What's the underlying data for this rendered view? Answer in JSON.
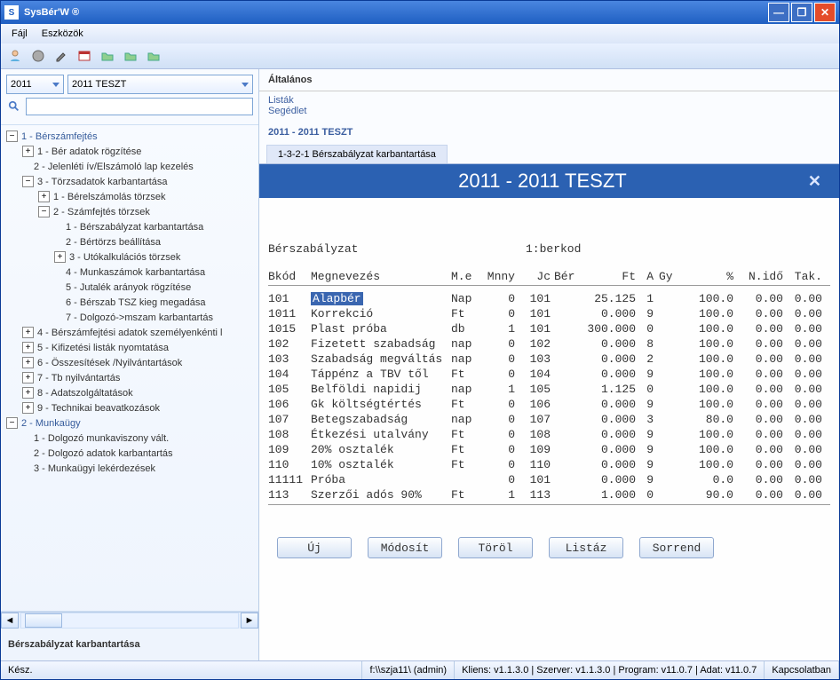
{
  "window": {
    "title": "SysBér'W ®"
  },
  "menu": {
    "file": "Fájl",
    "tools": "Eszközök"
  },
  "sidebar": {
    "year": "2011",
    "name": "2011 TESZT",
    "search_placeholder": "",
    "bottom_label": "Bérszabályzat karbantartása"
  },
  "tree": {
    "n1": "1 - Bérszámfejtés",
    "n1_1": "1 - Bér adatok rögzítése",
    "n1_2": "2 - Jelenléti ív/Elszámoló lap kezelés",
    "n1_3": "3 - Törzsadatok karbantartása",
    "n1_3_1": "1 - Bérelszámolás törzsek",
    "n1_3_2": "2 - Számfejtés törzsek",
    "n1_3_2_1": "1 - Bérszabályzat karbantartása",
    "n1_3_2_2": "2 - Bértörzs beállítása",
    "n1_3_2_3": "3 - Utókalkulációs törzsek",
    "n1_3_2_4": "4 - Munkaszámok karbantartása",
    "n1_3_2_5": "5 - Jutalék arányok rögzítése",
    "n1_3_2_6": "6 - Bérszab TSZ kieg megadása",
    "n1_3_2_7": "7 - Dolgozó->mszam karbantartás",
    "n1_4": "4 - Bérszámfejtési adatok személyenkénti l",
    "n1_5": "5 - Kifizetési listák nyomtatása",
    "n1_6": "6 - Összesítések /Nyilvántartások",
    "n1_7": "7 - Tb nyilvántartás",
    "n1_8": "8 - Adatszolgáltatások",
    "n1_9": "9 - Technikai beavatkozások",
    "n2": "2 - Munkaügy",
    "n2_1": "1 - Dolgozó munkaviszony vált.",
    "n2_2": "2 - Dolgozó adatok karbantartás",
    "n2_3": "3 - Munkaügyi lekérdezések"
  },
  "nav": {
    "head": "Általános",
    "link_listak": "Listák",
    "link_segedlet": "Segédlet",
    "sub": "2011 - 2011 TESZT",
    "tab": "1-3-2-1 Bérszabályzat karbantartása"
  },
  "form": {
    "title": "2011 - 2011 TESZT",
    "header_left": "Bérszabályzat",
    "header_right": "1:berkod",
    "cols": {
      "bkod": "Bkód",
      "meg": "Megnevezés",
      "me": "M.e",
      "mnny": "Mnny",
      "jc": "Jc",
      "ber": "Bér",
      "ft": "Ft",
      "a": "A",
      "gy": "Gy",
      "pct": "%",
      "nido": "N.idő",
      "tak": "Tak."
    },
    "rows": [
      {
        "bkod": "101",
        "meg": "Alapbér",
        "me": "Nap",
        "mnny": "0",
        "jc": "101",
        "ft": "25.125",
        "a": "1",
        "pct": "100.0",
        "nido": "0.00",
        "tak": "0.00",
        "sel": true
      },
      {
        "bkod": "1011",
        "meg": "Korrekció",
        "me": "Ft",
        "mnny": "0",
        "jc": "101",
        "ft": "0.000",
        "a": "9",
        "pct": "100.0",
        "nido": "0.00",
        "tak": "0.00"
      },
      {
        "bkod": "1015",
        "meg": "Plast próba",
        "me": "db",
        "mnny": "1",
        "jc": "101",
        "ft": "300.000",
        "a": "0",
        "pct": "100.0",
        "nido": "0.00",
        "tak": "0.00"
      },
      {
        "bkod": "102",
        "meg": "Fizetett szabadság",
        "me": "nap",
        "mnny": "0",
        "jc": "102",
        "ft": "0.000",
        "a": "8",
        "pct": "100.0",
        "nido": "0.00",
        "tak": "0.00"
      },
      {
        "bkod": "103",
        "meg": "Szabadság megváltás",
        "me": "nap",
        "mnny": "0",
        "jc": "103",
        "ft": "0.000",
        "a": "2",
        "pct": "100.0",
        "nido": "0.00",
        "tak": "0.00"
      },
      {
        "bkod": "104",
        "meg": "Táppénz a TBV től",
        "me": "Ft",
        "mnny": "0",
        "jc": "104",
        "ft": "0.000",
        "a": "9",
        "pct": "100.0",
        "nido": "0.00",
        "tak": "0.00"
      },
      {
        "bkod": "105",
        "meg": "Belföldi napidij",
        "me": "nap",
        "mnny": "1",
        "jc": "105",
        "ft": "1.125",
        "a": "0",
        "pct": "100.0",
        "nido": "0.00",
        "tak": "0.00"
      },
      {
        "bkod": "106",
        "meg": "Gk költségtértés",
        "me": "Ft",
        "mnny": "0",
        "jc": "106",
        "ft": "0.000",
        "a": "9",
        "pct": "100.0",
        "nido": "0.00",
        "tak": "0.00"
      },
      {
        "bkod": "107",
        "meg": "Betegszabadság",
        "me": "nap",
        "mnny": "0",
        "jc": "107",
        "ft": "0.000",
        "a": "3",
        "pct": "80.0",
        "nido": "0.00",
        "tak": "0.00"
      },
      {
        "bkod": "108",
        "meg": "Étkezési utalvány",
        "me": "Ft",
        "mnny": "0",
        "jc": "108",
        "ft": "0.000",
        "a": "9",
        "pct": "100.0",
        "nido": "0.00",
        "tak": "0.00"
      },
      {
        "bkod": "109",
        "meg": "20% osztalék",
        "me": "Ft",
        "mnny": "0",
        "jc": "109",
        "ft": "0.000",
        "a": "9",
        "pct": "100.0",
        "nido": "0.00",
        "tak": "0.00"
      },
      {
        "bkod": "110",
        "meg": "10% osztalék",
        "me": "Ft",
        "mnny": "0",
        "jc": "110",
        "ft": "0.000",
        "a": "9",
        "pct": "100.0",
        "nido": "0.00",
        "tak": "0.00"
      },
      {
        "bkod": "11111",
        "meg": "Próba",
        "me": "",
        "mnny": "0",
        "jc": "101",
        "ft": "0.000",
        "a": "9",
        "pct": "0.0",
        "nido": "0.00",
        "tak": "0.00"
      },
      {
        "bkod": "113",
        "meg": "Szerzői adós 90%",
        "me": "Ft",
        "mnny": "1",
        "jc": "113",
        "ft": "1.000",
        "a": "0",
        "pct": "90.0",
        "nido": "0.00",
        "tak": "0.00"
      }
    ],
    "buttons": {
      "uj": "Új",
      "modosit": "Módosít",
      "torol": "Töröl",
      "listaz": "Listáz",
      "sorrend": "Sorrend"
    }
  },
  "status": {
    "ready": "Kész.",
    "path": "f:\\\\szja11\\ (admin)",
    "version": "Kliens: v1.1.3.0 | Szerver: v1.1.3.0 | Program: v11.0.7 | Adat: v11.0.7",
    "conn": "Kapcsolatban"
  }
}
